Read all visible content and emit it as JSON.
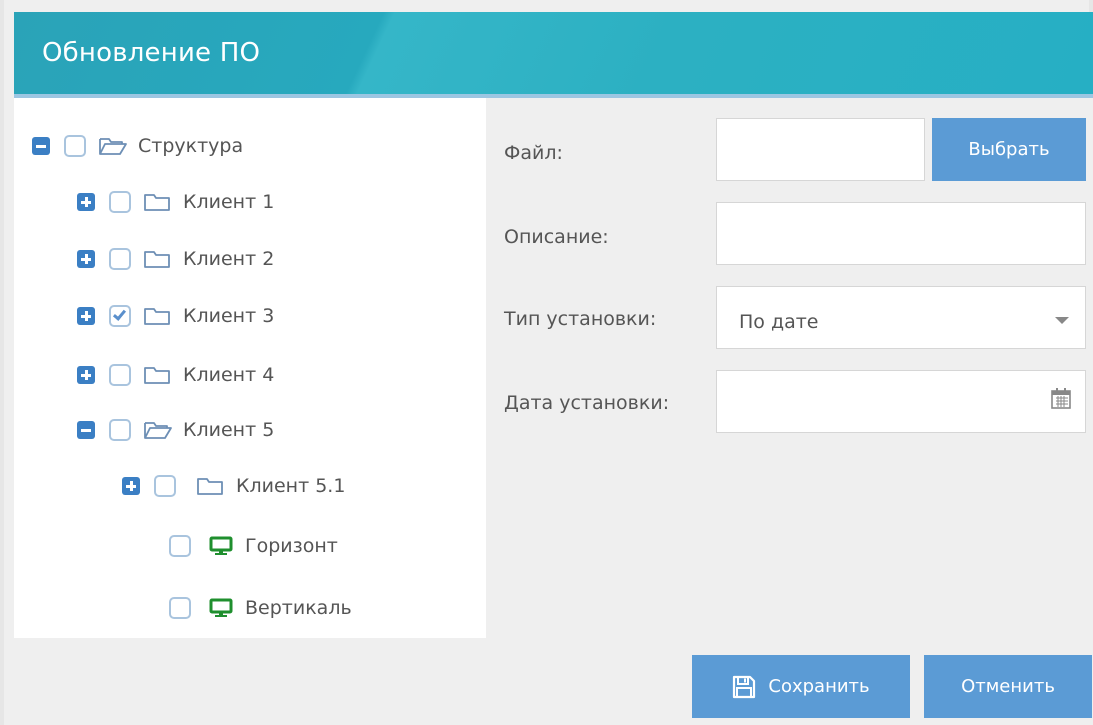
{
  "dialog": {
    "title": "Обновление ПО"
  },
  "tree": {
    "root": {
      "label": "Структура",
      "expanded": true,
      "checked": false
    },
    "nodes": [
      {
        "label": "Клиент 1",
        "expanded": false,
        "checked": false
      },
      {
        "label": "Клиент 2",
        "expanded": false,
        "checked": false
      },
      {
        "label": "Клиент 3",
        "expanded": false,
        "checked": true
      },
      {
        "label": "Клиент 4",
        "expanded": false,
        "checked": false
      },
      {
        "label": "Клиент 5",
        "expanded": true,
        "checked": false
      }
    ],
    "sub": {
      "label": "Клиент 5.1",
      "expanded": false,
      "checked": false
    },
    "devices": [
      {
        "label": "Горизонт",
        "checked": false,
        "icon": "monitor-icon"
      },
      {
        "label": "Вертикаль",
        "checked": false,
        "icon": "monitor-icon"
      }
    ]
  },
  "form": {
    "file_label": "Файл:",
    "file_value": "",
    "browse_button": "Выбрать",
    "description_label": "Описание:",
    "description_value": "",
    "install_type_label": "Тип установки:",
    "install_type_value": "По дате",
    "install_date_label": "Дата установки:",
    "install_date_value": ""
  },
  "footer": {
    "save_button": "Сохранить",
    "cancel_button": "Отменить"
  },
  "colors": {
    "header": "#2aa3b8",
    "accent": "#5b9bd5",
    "toggle": "#3b7fc4",
    "device_icon": "#1f8f2e"
  }
}
